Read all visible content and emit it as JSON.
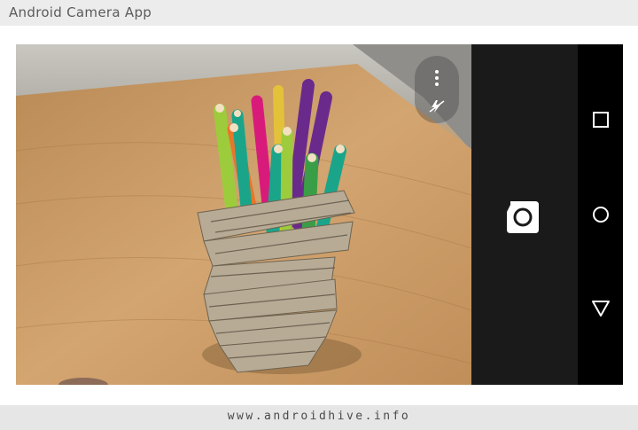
{
  "page": {
    "title": "Android Camera App",
    "footer": "www.androidhive.info"
  },
  "viewfinder": {
    "subject": "pencil holder with colored pencils on wooden table",
    "colors": {
      "wall": "#bdbdb8",
      "table": "#c49a63",
      "holder": "#b7ab96",
      "pencils": [
        "#9ccc3c",
        "#e8762a",
        "#1aa58a",
        "#d81b7a",
        "#6a2a8c",
        "#3a9e46",
        "#e3c23a"
      ]
    }
  },
  "overlay": {
    "menu_icon": "more-vert-icon",
    "flash_icon": "flash-off-icon"
  },
  "controls": {
    "shutter_icon": "camera-icon",
    "strip_color": "#1a1a1a"
  },
  "nav": {
    "recents_icon": "square-icon",
    "home_icon": "circle-icon",
    "back_icon": "triangle-icon"
  }
}
